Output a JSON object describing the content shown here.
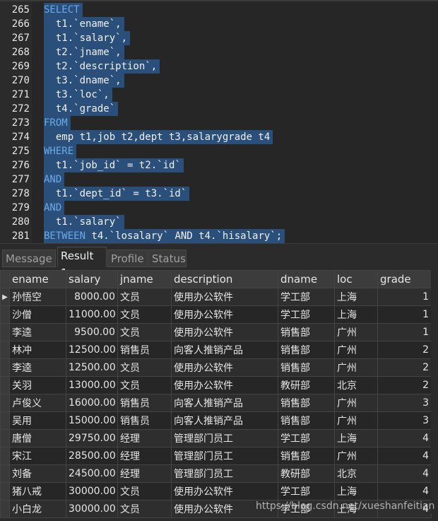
{
  "editor": {
    "lines": [
      {
        "n": "265",
        "t": "SELECT",
        "kw": true
      },
      {
        "n": "266",
        "t": "  t1.`ename`,"
      },
      {
        "n": "267",
        "t": "  t1.`salary`,"
      },
      {
        "n": "268",
        "t": "  t2.`jname`,"
      },
      {
        "n": "269",
        "t": "  t2.`description`,"
      },
      {
        "n": "270",
        "t": "  t3.`dname`,"
      },
      {
        "n": "271",
        "t": "  t3.`loc`,"
      },
      {
        "n": "272",
        "t": "  t4.`grade`"
      },
      {
        "n": "273",
        "t": "FROM",
        "kw": true
      },
      {
        "n": "274",
        "t": "  emp t1,job t2,dept t3,salarygrade t4"
      },
      {
        "n": "275",
        "t": "WHERE",
        "kw": true
      },
      {
        "n": "276",
        "t": "  t1.`job_id` = t2.`id`"
      },
      {
        "n": "277",
        "t": "AND",
        "kw": true
      },
      {
        "n": "278",
        "t": "  t1.`dept_id` = t3.`id`"
      },
      {
        "n": "279",
        "t": "AND",
        "kw": true
      },
      {
        "n": "280",
        "t": "  t1.`salary`"
      },
      {
        "n": "281",
        "kwpart": "BETWEEN",
        "t": " t4.`losalary` AND t4.`hisalary`;"
      }
    ]
  },
  "tabs": [
    {
      "label": "Message"
    },
    {
      "label": "Result 1",
      "active": true
    },
    {
      "label": "Profile"
    },
    {
      "label": "Status"
    }
  ],
  "table": {
    "columns": [
      "ename",
      "salary",
      "jname",
      "description",
      "dname",
      "loc",
      "grade"
    ],
    "rows": [
      [
        "孙悟空",
        "8000.00",
        "文员",
        "使用办公软件",
        "学工部",
        "上海",
        "1"
      ],
      [
        "沙僧",
        "11000.00",
        "文员",
        "使用办公软件",
        "学工部",
        "上海",
        "1"
      ],
      [
        "李逵",
        "9500.00",
        "文员",
        "使用办公软件",
        "销售部",
        "广州",
        "1"
      ],
      [
        "林冲",
        "12500.00",
        "销售员",
        "向客人推销产品",
        "销售部",
        "广州",
        "2"
      ],
      [
        "李逵",
        "12500.00",
        "文员",
        "使用办公软件",
        "销售部",
        "广州",
        "2"
      ],
      [
        "关羽",
        "13000.00",
        "文员",
        "使用办公软件",
        "教研部",
        "北京",
        "2"
      ],
      [
        "卢俊义",
        "16000.00",
        "销售员",
        "向客人推销产品",
        "销售部",
        "广州",
        "3"
      ],
      [
        "吴用",
        "15000.00",
        "销售员",
        "向客人推销产品",
        "销售部",
        "广州",
        "3"
      ],
      [
        "唐僧",
        "29750.00",
        "经理",
        "管理部门员工",
        "学工部",
        "上海",
        "4"
      ],
      [
        "宋江",
        "28500.00",
        "经理",
        "管理部门员工",
        "销售部",
        "广州",
        "4"
      ],
      [
        "刘备",
        "24500.00",
        "经理",
        "管理部门员工",
        "教研部",
        "北京",
        "4"
      ],
      [
        "猪八戒",
        "30000.00",
        "文员",
        "使用办公软件",
        "学工部",
        "上海",
        "4"
      ],
      [
        "小白龙",
        "30000.00",
        "文员",
        "使用办公软件",
        "学工部",
        "上海",
        "4"
      ]
    ]
  },
  "watermark": "https://blog.csdn.net/xueshanfeitian",
  "colors": {
    "selection": "#2a4f7a",
    "keyword": "#6aaae8"
  }
}
